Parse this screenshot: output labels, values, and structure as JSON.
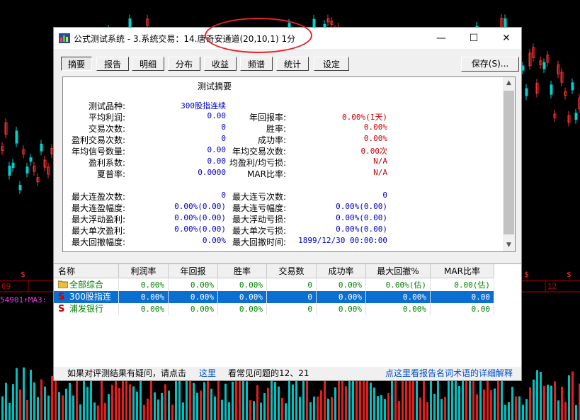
{
  "window": {
    "title": "公式测试系统 - 3.系统交易：14.唐奇安通道(20,10,1) 1分",
    "controls": {
      "minimize": "—",
      "maximize": "☐",
      "close": "✕"
    }
  },
  "tabs": [
    "摘要",
    "报告",
    "明细",
    "分布",
    "收益",
    "频谱",
    "统计",
    "设定"
  ],
  "save_button": "保存(S)...",
  "summary": {
    "title": "测试摘要",
    "left_labels": [
      "测试品种:",
      "平均利润:",
      "交易次数:",
      "盈利交易次数:",
      "年均信号数量:",
      "盈利系数:",
      "夏普率:"
    ],
    "left_values": [
      "300股指连续",
      "0.00",
      "0",
      "0",
      "0.00",
      "0.00",
      "0.0000"
    ],
    "right_labels": [
      "年回报率:",
      "胜率:",
      "成功率:",
      "年均交易次数:",
      "均盈利/均亏损:",
      "MAR比率:"
    ],
    "right_values": [
      "0.00%(1天)",
      "0.00%",
      "0.00%",
      "0.00次",
      "N/A",
      "N/A"
    ],
    "max_left_labels": [
      "最大连盈次数:",
      "最大连盈幅度:",
      "最大浮动盈利:",
      "最大单次盈利:",
      "最大回撤幅度:"
    ],
    "max_left_values": [
      "0",
      "0.00%(0.00)",
      "0.00%(0.00)",
      "0.00%(0.00)",
      "0.00%"
    ],
    "max_right_labels": [
      "最大连亏次数:",
      "最大连亏幅度:",
      "最大浮动亏损:",
      "最大单次亏损:",
      "最大回撤时间:"
    ],
    "max_right_values": [
      "0",
      "0.00%(0.00)",
      "0.00%(0.00)",
      "0.00%(0.00)",
      "1899/12/30 00:00:00"
    ]
  },
  "table": {
    "headers": [
      "名称",
      "利润率",
      "年回报",
      "胜率",
      "交易数",
      "成功率",
      "最大回撤%",
      "MAR比率"
    ],
    "rows": [
      {
        "icon": "folder-icon",
        "name": "全部综合",
        "cells": [
          "0.00%",
          "0.00%",
          "0.00%",
          "0",
          "0.00%",
          "0.00%(估)",
          "0.00(估)"
        ],
        "selected": false
      },
      {
        "icon": "S",
        "name": "300股指连续",
        "cells": [
          "0.00%",
          "0.00%",
          "0.00%",
          "0",
          "0.00%",
          "0.00%",
          "0.00"
        ],
        "selected": true
      },
      {
        "icon": "S",
        "name": "浦发银行",
        "cells": [
          "0.00%",
          "0.00%",
          "0.00%",
          "0",
          "0.00%",
          "0.00%",
          "0.00"
        ],
        "selected": false
      }
    ]
  },
  "footer": {
    "prefix": "如果对评测结果有疑问，请点击",
    "link1": "这里",
    "middle": "看常见问题的12、21",
    "link2": "点这里看报告名词术语的详细解释"
  },
  "background": {
    "axis_left": "09",
    "axis_right": "12",
    "ma_readout": "54901↑MA3:",
    "marker": "$"
  },
  "colors": {
    "accent_blue": "#0000c8",
    "value_red": "#c80000",
    "selection": "#0b6fd2",
    "annotation_red": "#e8212b"
  }
}
